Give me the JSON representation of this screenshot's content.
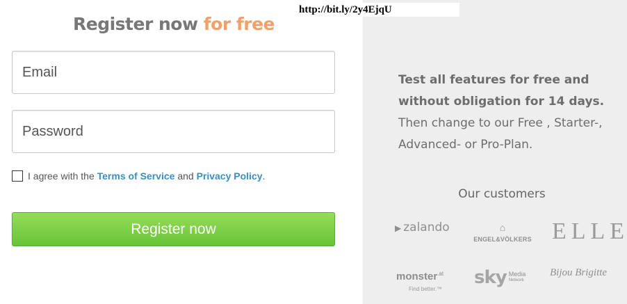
{
  "overlay": {
    "url_text": "http://bit.ly/2y4EjqU"
  },
  "form": {
    "title_main": "Register now",
    "title_accent": "for free",
    "email_placeholder": "Email",
    "password_placeholder": "Password",
    "agree_prefix": "I agree with the",
    "terms_link": "Terms of Service",
    "agree_and": "and",
    "privacy_link": "Privacy Policy",
    "agree_suffix": ".",
    "checkbox_checked": false,
    "submit_label": "Register now"
  },
  "promo": {
    "line1_bold": "Test all features for free and",
    "line2_bold": "without obligation for 14 days.",
    "line3": "Then change to our Free , Starter-,",
    "line4": "Advanced- or Pro-Plan."
  },
  "customers": {
    "title": "Our customers",
    "logos": {
      "zalando": "zalando",
      "engel_voelkers": "ENGEL&VÖLKERS",
      "elle": "ELLE",
      "monster": "monster",
      "monster_suffix": ".at",
      "monster_tagline": "Find better.™",
      "sky": "sky",
      "sky_media": "Media",
      "sky_network": "Network",
      "bijou": "Bijou Brigitte"
    }
  },
  "colors": {
    "accent_orange": "#f2a06a",
    "link_blue": "#3a8fc2",
    "button_green": "#68c437",
    "panel_gray": "#eeeeee"
  }
}
